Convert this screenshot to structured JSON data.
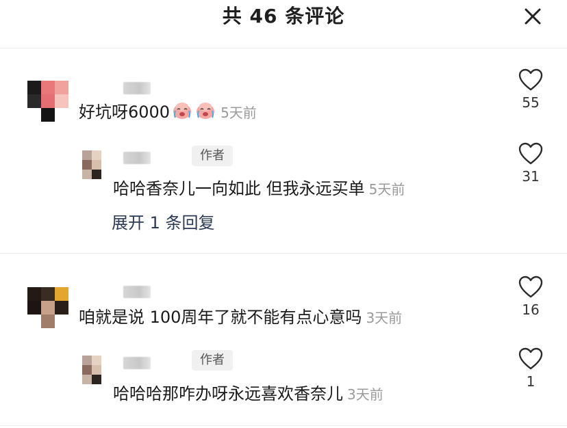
{
  "header": {
    "title": "共 46 条评论",
    "close_icon": "close-icon"
  },
  "comments": [
    {
      "text": "好坑呀6000",
      "emoji": [
        "crying-face-emoji",
        "crying-face-emoji"
      ],
      "time": "5天前",
      "likes": "55",
      "reply": {
        "author_tag": "作者",
        "text": "哈哈香奈儿一向如此 但我永远买单",
        "time": "5天前",
        "likes": "31",
        "expand_label": "展开 1 条回复"
      }
    },
    {
      "text": "咱就是说 100周年了就不能有点心意吗",
      "time": "3天前",
      "likes": "16",
      "reply": {
        "author_tag": "作者",
        "text": "哈哈哈那咋办呀永远喜欢香奈儿",
        "time": "3天前",
        "likes": "1"
      }
    }
  ],
  "colors": {
    "accent_link": "#2a3a55",
    "muted": "#9a9a9a",
    "tag_bg": "#f0f0f0"
  }
}
